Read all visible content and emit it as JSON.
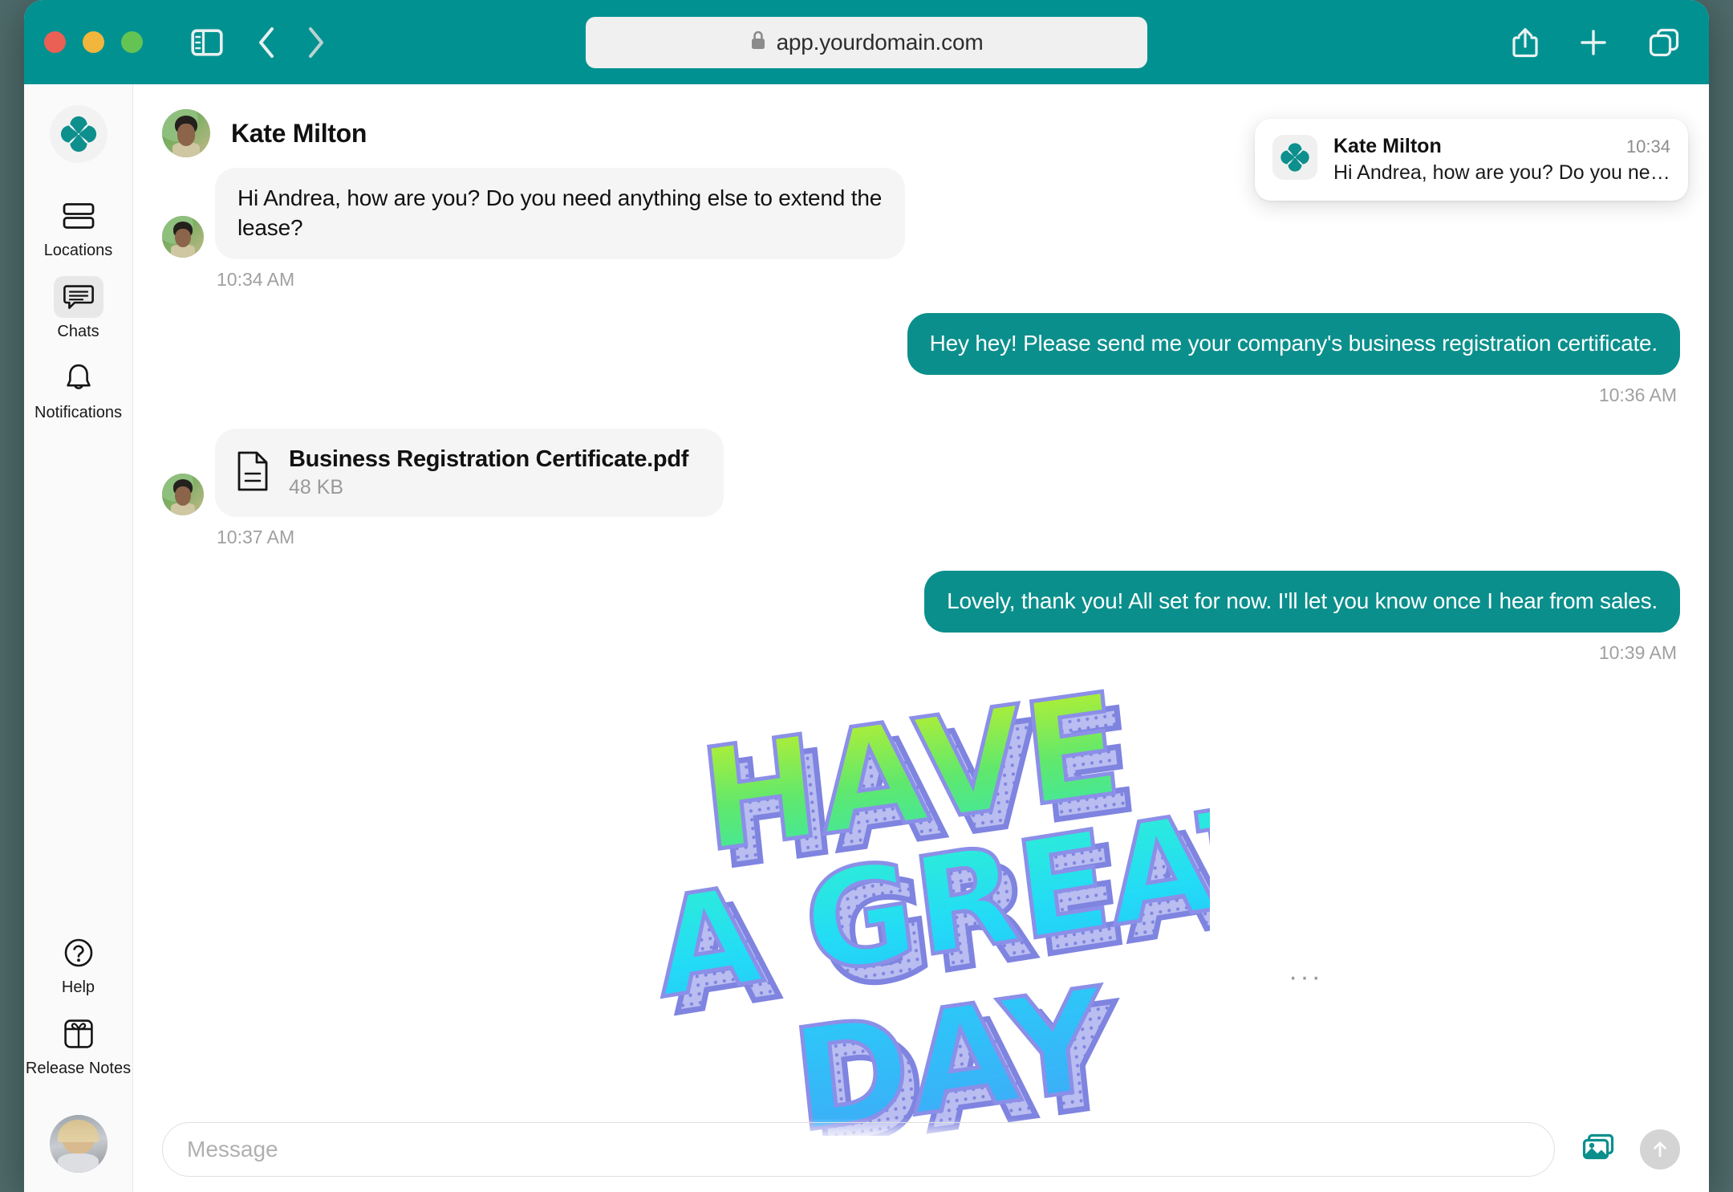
{
  "browser": {
    "url": "app.yourdomain.com",
    "lock_icon": "lock-icon",
    "traffic_lights": [
      "close",
      "minimize",
      "zoom"
    ],
    "toolbar": {
      "sidebar_toggle": "sidebar-toggle-icon",
      "back": "chevron-left-icon",
      "forward": "chevron-right-icon",
      "share": "share-icon",
      "new_tab": "plus-icon",
      "tab_overview": "tabs-icon"
    },
    "accent_color": "#029191"
  },
  "sidebar": {
    "logo_name": "clover-logo",
    "items": [
      {
        "label": "Locations",
        "icon": "stacked-bars-icon",
        "active": false
      },
      {
        "label": "Chats",
        "icon": "chat-bubble-icon",
        "active": true
      },
      {
        "label": "Notifications",
        "icon": "bell-icon",
        "active": false
      }
    ],
    "bottom_items": [
      {
        "label": "Help",
        "icon": "question-circle-icon"
      },
      {
        "label": "Release Notes",
        "icon": "gift-icon"
      }
    ],
    "user_avatar": "user-avatar"
  },
  "chat": {
    "header": {
      "name": "Kate Milton",
      "avatar": "kate-avatar"
    },
    "messages": [
      {
        "id": "m1",
        "direction": "in",
        "type": "text",
        "text": "Hi Andrea, how are you? Do you need anything else to extend the lease?",
        "time": "10:34 AM",
        "avatar": "kate-avatar"
      },
      {
        "id": "m2",
        "direction": "out",
        "type": "text",
        "text": "Hey hey! Please send me your company's business registration certificate.",
        "time": "10:36 AM"
      },
      {
        "id": "m3",
        "direction": "in",
        "type": "file",
        "file_name": "Business Registration Certificate.pdf",
        "file_size": "48 KB",
        "file_icon": "document-icon",
        "time": "10:37 AM",
        "avatar": "kate-avatar"
      },
      {
        "id": "m4",
        "direction": "out",
        "type": "text",
        "text": "Lovely, thank you! All set for now. I'll let you know once I hear from sales.",
        "time": "10:39 AM"
      },
      {
        "id": "m5",
        "direction": "out",
        "type": "gif",
        "gif_text_lines": [
          "HAVE",
          "A GREAT",
          "DAY"
        ],
        "gif_alt": "have-a-great-day-gif",
        "more_label": "···"
      }
    ],
    "bubble_out_color": "#0b8f8c",
    "bubble_in_color": "#f5f5f5"
  },
  "composer": {
    "placeholder": "Message",
    "value": "",
    "media_button": "image-stack-icon",
    "send_button": "send-arrow-up-icon"
  },
  "toast": {
    "app_icon": "clover-logo",
    "title": "Kate Milton",
    "time": "10:34",
    "preview": "Hi Andrea, how are you? Do you need any…"
  }
}
